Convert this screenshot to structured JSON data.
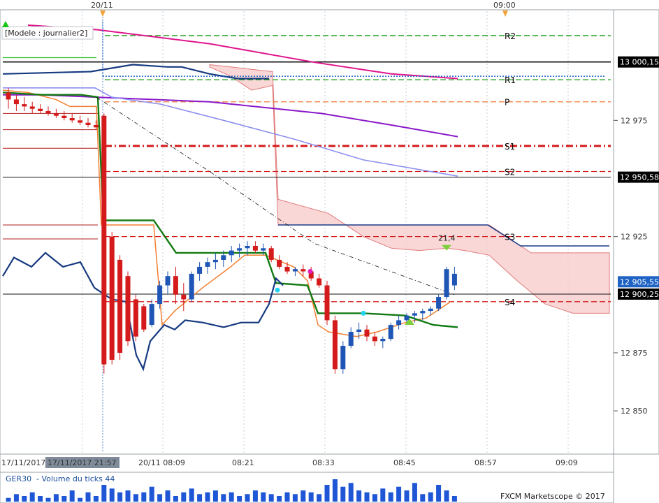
{
  "chart_data": {
    "type": "candlestick",
    "instrument": "GER30",
    "title_box": "[Modele : journalier2]",
    "copyright": "FXCM Marketscope © 2017",
    "top_markers": [
      "20/11",
      "09:00"
    ],
    "x_ticks": [
      "17/11/2017",
      "17/11/2017 21:57",
      "20/11 08:09",
      "08:21",
      "08:33",
      "08:45",
      "08:57",
      "09:09"
    ],
    "y_ticks": [
      "12 975",
      "12 925",
      "12 875",
      "12 850"
    ],
    "ylim": [
      12832,
      13022
    ],
    "price_badges": [
      {
        "value": 13000.15,
        "label": "13 000,15",
        "color": "#000000"
      },
      {
        "value": 12950.58,
        "label": "12 950,58",
        "color": "#000000"
      },
      {
        "value": 12905.55,
        "label": "12 905,55",
        "color": "#1f63c4"
      },
      {
        "value": 12900.25,
        "label": "12 900,25",
        "color": "#000000"
      }
    ],
    "pivot_levels": [
      {
        "name": "R2",
        "value": 13011.5
      },
      {
        "name": "R1",
        "value": 12992.5
      },
      {
        "name": "P",
        "value": 12983
      },
      {
        "name": "S1",
        "value": 12964
      },
      {
        "name": "S2",
        "value": 12953
      },
      {
        "name": "S3",
        "value": 12925
      },
      {
        "name": "S4",
        "value": 12897
      }
    ],
    "annotation": {
      "label": "21,4",
      "index": 55
    },
    "candles": [
      [
        12987,
        12989,
        12980,
        12984
      ],
      [
        12984,
        12986,
        12979,
        12982
      ],
      [
        12982,
        12985,
        12979,
        12981
      ],
      [
        12981,
        12983,
        12978,
        12980
      ],
      [
        12980,
        12982,
        12978,
        12979
      ],
      [
        12979,
        12981,
        12977,
        12978
      ],
      [
        12978,
        12980,
        12976,
        12977
      ],
      [
        12977,
        12979,
        12975,
        12976
      ],
      [
        12976,
        12978,
        12974,
        12975
      ],
      [
        12975,
        12977,
        12973,
        12974
      ],
      [
        12974,
        12976,
        12972,
        12973
      ],
      [
        12973,
        12975,
        12971,
        12972
      ],
      [
        12977,
        12978,
        12866,
        12870
      ],
      [
        12925,
        12927,
        12870,
        12872
      ],
      [
        12915,
        12917,
        12872,
        12875
      ],
      [
        12908,
        12910,
        12878,
        12880
      ],
      [
        12898,
        12900,
        12880,
        12882
      ],
      [
        12895,
        12896,
        12884,
        12885
      ],
      [
        12887,
        12898,
        12886,
        12896
      ],
      [
        12896,
        12906,
        12894,
        12904
      ],
      [
        12904,
        12910,
        12900,
        12908
      ],
      [
        12908,
        12912,
        12896,
        12900
      ],
      [
        12900,
        12905,
        12893,
        12898
      ],
      [
        12898,
        12910,
        12897,
        12909
      ],
      [
        12909,
        12914,
        12906,
        12912
      ],
      [
        12912,
        12916,
        12909,
        12914
      ],
      [
        12914,
        12918,
        12911,
        12915
      ],
      [
        12915,
        12919,
        12912,
        12917
      ],
      [
        12917,
        12921,
        12914,
        12919
      ],
      [
        12919,
        12922,
        12916,
        12920
      ],
      [
        12920,
        12923,
        12917,
        12921
      ],
      [
        12921,
        12923,
        12918,
        12919
      ],
      [
        12919,
        12922,
        12917,
        12920
      ],
      [
        12920,
        12921,
        12914,
        12915
      ],
      [
        12915,
        12917,
        12911,
        12912
      ],
      [
        12912,
        12914,
        12909,
        12910
      ],
      [
        12910,
        12912,
        12908,
        12911
      ],
      [
        12911,
        12913,
        12908,
        12910
      ],
      [
        12910,
        12912,
        12906,
        12907
      ],
      [
        12907,
        12909,
        12903,
        12904
      ],
      [
        12904,
        12906,
        12887,
        12889
      ],
      [
        12889,
        12891,
        12866,
        12868
      ],
      [
        12868,
        12880,
        12866,
        12878
      ],
      [
        12878,
        12886,
        12877,
        12884
      ],
      [
        12884,
        12888,
        12881,
        12885
      ],
      [
        12885,
        12887,
        12880,
        12882
      ],
      [
        12882,
        12884,
        12878,
        12880
      ],
      [
        12880,
        12882,
        12877,
        12881
      ],
      [
        12881,
        12888,
        12880,
        12887
      ],
      [
        12887,
        12891,
        12885,
        12889
      ],
      [
        12889,
        12892,
        12887,
        12891
      ],
      [
        12891,
        12893,
        12888,
        12892
      ],
      [
        12892,
        12894,
        12889,
        12893
      ],
      [
        12893,
        12895,
        12891,
        12894
      ],
      [
        12894,
        12900,
        12893,
        12899
      ],
      [
        12899,
        12912,
        12898,
        12911
      ],
      [
        12904,
        12912,
        12902,
        12909
      ]
    ],
    "volume": [
      2,
      4,
      3,
      5,
      3,
      2,
      4,
      3,
      6,
      2,
      5,
      3,
      9,
      7,
      5,
      6,
      4,
      5,
      8,
      4,
      6,
      3,
      5,
      7,
      4,
      5,
      6,
      4,
      5,
      3,
      4,
      6,
      5,
      4,
      3,
      5,
      4,
      6,
      5,
      4,
      9,
      12,
      8,
      10,
      6,
      5,
      4,
      7,
      5,
      8,
      6,
      10,
      4,
      5,
      9,
      6,
      3
    ]
  }
}
